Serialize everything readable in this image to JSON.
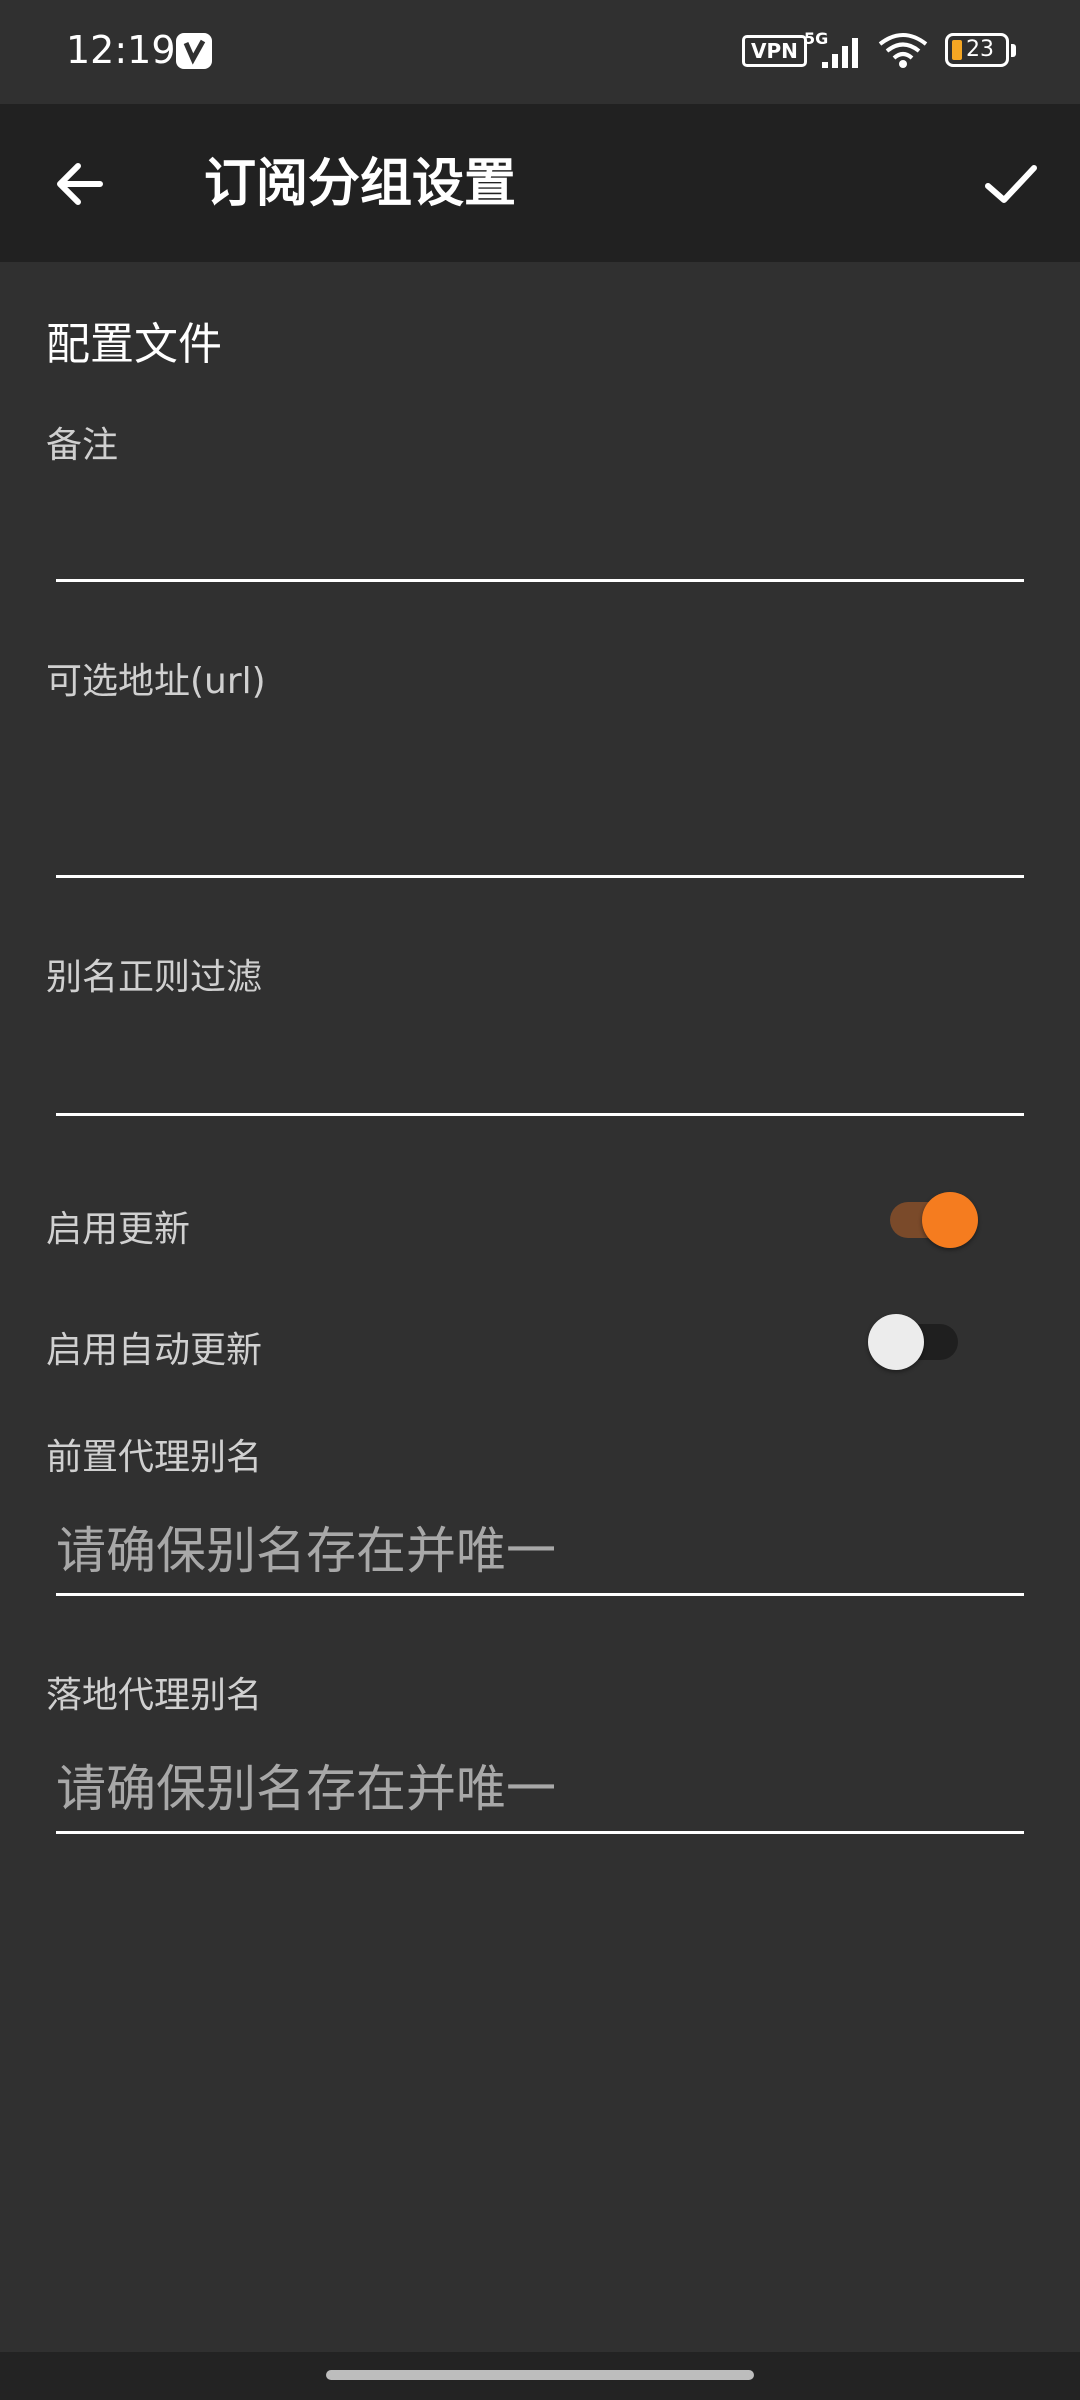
{
  "status_bar": {
    "time": "12:19",
    "vpn_label": "VPN",
    "network_type": "5G",
    "battery_level": "23",
    "icons": [
      "notification-app-icon",
      "vpn-icon",
      "signal-icon",
      "wifi-icon",
      "battery-icon"
    ]
  },
  "app_bar": {
    "title": "订阅分组设置",
    "back_icon": "arrow-left-icon",
    "done_icon": "check-icon"
  },
  "section": {
    "title": "配置文件"
  },
  "fields": {
    "remark": {
      "label": "备注",
      "value": ""
    },
    "url": {
      "label": "可选地址(url)",
      "value": ""
    },
    "alias_regex": {
      "label": "别名正则过滤",
      "value": ""
    },
    "front_proxy": {
      "label": "前置代理别名",
      "value": "",
      "placeholder": "请确保别名存在并唯一"
    },
    "landing_proxy": {
      "label": "落地代理别名",
      "value": "",
      "placeholder": "请确保别名存在并唯一"
    }
  },
  "toggles": {
    "enable_update": {
      "label": "启用更新",
      "on": true
    },
    "enable_auto_update": {
      "label": "启用自动更新",
      "on": false
    }
  },
  "colors": {
    "accent": "#F57C1F",
    "background": "#303030",
    "app_bar": "#212121"
  }
}
